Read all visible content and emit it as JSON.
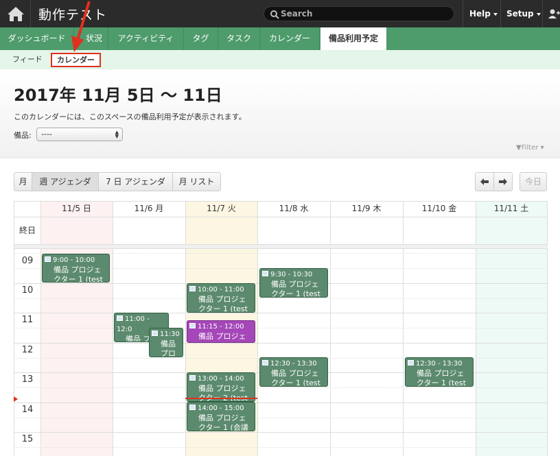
{
  "topbar": {
    "title": "動作テスト",
    "search_placeholder": "Search",
    "help": "Help",
    "setup": "Setup"
  },
  "tabs": [
    {
      "label": "ダッシュボード"
    },
    {
      "label": "状況"
    },
    {
      "label": "アクティビティ"
    },
    {
      "label": "タグ"
    },
    {
      "label": "タスク"
    },
    {
      "label": "カレンダー"
    },
    {
      "label": "備品利用予定"
    }
  ],
  "subnav": {
    "feed": "フィード",
    "calendar": "カレンダー"
  },
  "header": {
    "title": "2017年 11月 5日 〜 11日",
    "description": "このカレンダーには、このスペースの備品利用予定が表示されます。",
    "equip_label": "備品:",
    "equip_value": "----",
    "filter": "Filter"
  },
  "views": {
    "month": "月",
    "week_agenda": "週 アジェンダ",
    "seven_day_agenda": "7 日 アジェンダ",
    "month_list": "月 リスト",
    "today": "今日"
  },
  "calendar": {
    "days": [
      "11/5 日",
      "11/6 月",
      "11/7 火",
      "11/8 水",
      "11/9 木",
      "11/10 金",
      "11/11 土"
    ],
    "allday_label": "終日",
    "hours": [
      "09",
      "10",
      "11",
      "12",
      "13",
      "14",
      "15"
    ],
    "events": [
      {
        "time": "9:00 - 10:00",
        "title": "備品 プロジェクター 1 (test",
        "color": "#5c8a6e"
      },
      {
        "time": "9:30 - 10:30",
        "title": "備品 プロジェクター 1 (test",
        "color": "#5c8a6e"
      },
      {
        "time": "10:00 - 11:00",
        "title": "備品 プロジェクター 1 (test",
        "color": "#5c8a6e"
      },
      {
        "time": "11:00 - 12:0",
        "title": "備品 プロジェク",
        "color": "#5c8a6e"
      },
      {
        "time": "11:30",
        "title": "備品 プロ",
        "color": "#5c8a6e"
      },
      {
        "time": "11:15 - 12:00",
        "title": "備品 プロジェ",
        "color": "#a447b8"
      },
      {
        "time": "12:30 - 13:30",
        "title": "備品 プロジェクター 1 (test",
        "color": "#5c8a6e"
      },
      {
        "time": "12:30 - 13:30",
        "title": "備品 プロジェクター 1 (test",
        "color": "#5c8a6e"
      },
      {
        "time": "13:00 - 14:00",
        "title": "備品 プロジェクター 2 (test",
        "color": "#5c8a6e"
      },
      {
        "time": "14:00 - 15:00",
        "title": "備品 プロジェクター 1 (会議",
        "color": "#5c8a6e"
      }
    ]
  },
  "colors": {
    "topbar": "#2b2b2b",
    "tabbar": "#4e9b6c",
    "subnav": "#e4f5e9",
    "sunday_bg": "#fdf1f1",
    "today_bg": "#fcf6e2",
    "saturday_bg": "#eefaf6",
    "highlight": "#e0301e"
  }
}
